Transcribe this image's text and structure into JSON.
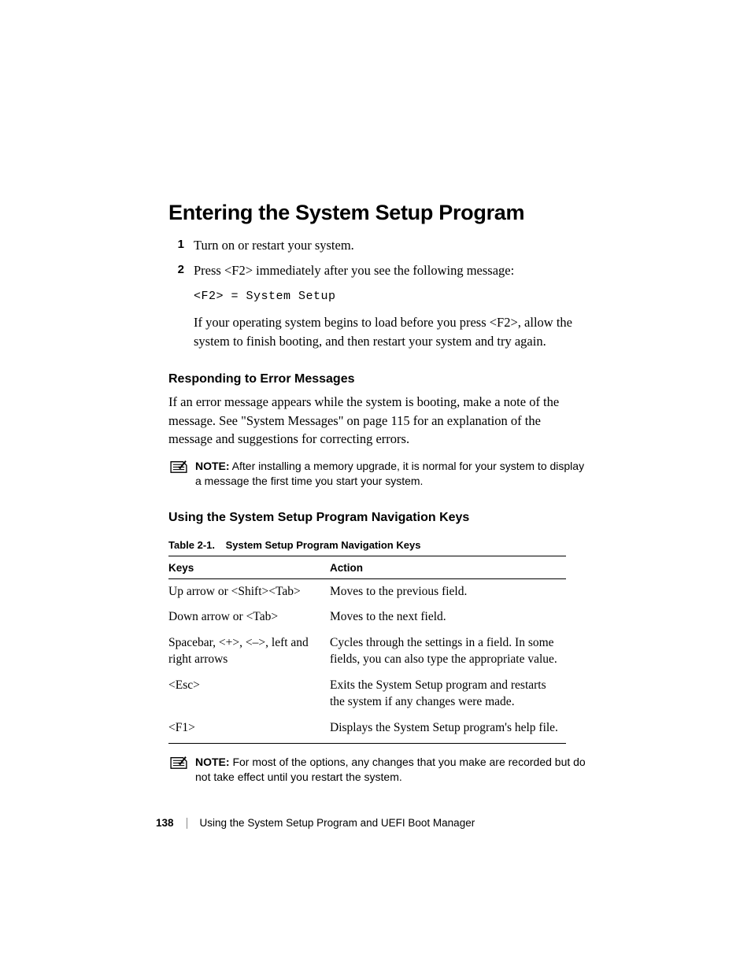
{
  "heading": "Entering the System Setup Program",
  "steps": [
    {
      "num": "1",
      "text": "Turn on or restart your system."
    },
    {
      "num": "2",
      "text": "Press <F2> immediately after you see the following message:",
      "code": "<F2> = System Setup",
      "after": "If your operating system begins to load before you press <F2>, allow the system to finish booting, and then restart your system and try again."
    }
  ],
  "section1": {
    "heading": "Responding to Error Messages",
    "para": "If an error message appears while the system is booting, make a note of the message. See \"System Messages\" on page 115 for an explanation of the message and suggestions for correcting errors.",
    "note_label": "NOTE:",
    "note_text": " After installing a memory upgrade, it is normal for your system to display a message the first time you start your system."
  },
  "section2": {
    "heading": "Using the System Setup Program Navigation Keys",
    "table_caption_num": "Table 2-1.",
    "table_caption_title": "System Setup Program Navigation Keys",
    "col1": "Keys",
    "col2": "Action",
    "rows": [
      {
        "k": "Up arrow or <Shift><Tab>",
        "a": "Moves to the previous field."
      },
      {
        "k": "Down arrow or <Tab>",
        "a": "Moves to the next field."
      },
      {
        "k": "Spacebar, <+>, <–>, left and right arrows",
        "a": "Cycles through the settings in a field. In some fields, you can also type the appropriate value."
      },
      {
        "k": "<Esc>",
        "a": "Exits the System Setup program and restarts the system if any changes were made."
      },
      {
        "k": "<F1>",
        "a": "Displays the System Setup program's help file."
      }
    ],
    "note_label": "NOTE:",
    "note_text": " For most of the options, any changes that you make are recorded but do not take effect until you restart the system."
  },
  "footer": {
    "page_num": "138",
    "title": "Using the System Setup Program and UEFI Boot Manager"
  }
}
